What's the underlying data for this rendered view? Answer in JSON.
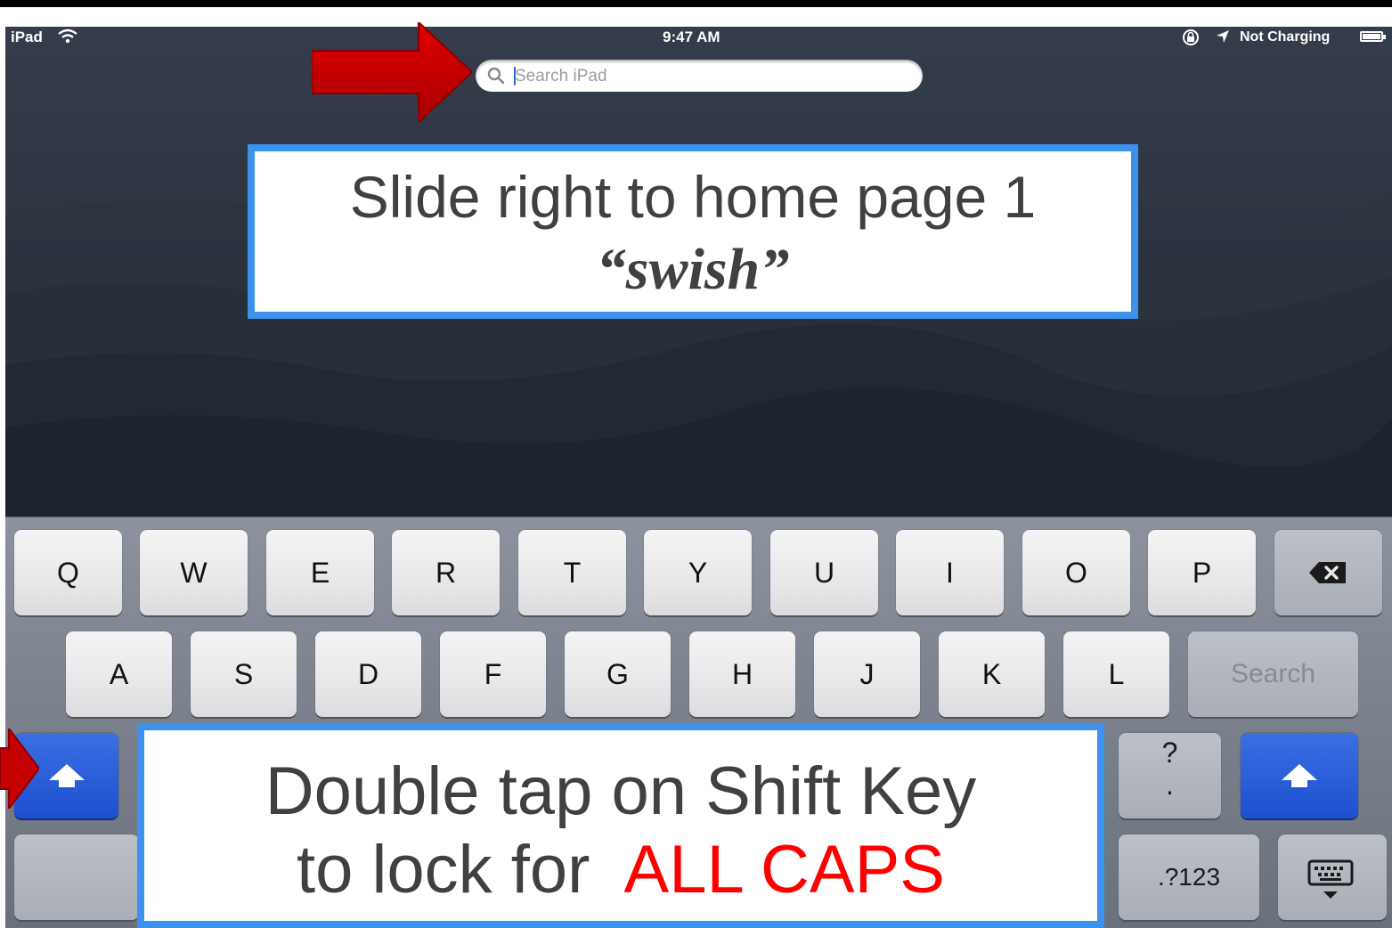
{
  "status_bar": {
    "device": "iPad",
    "time": "9:47 AM",
    "charging": "Not Charging",
    "wifi_icon": "wifi-icon",
    "lock_icon": "rotation-lock-icon",
    "location_icon": "location-arrow-icon",
    "battery_icon": "battery-icon"
  },
  "search": {
    "placeholder": "Search iPad",
    "icon": "search-icon"
  },
  "keyboard": {
    "row1": [
      "Q",
      "W",
      "E",
      "R",
      "T",
      "Y",
      "U",
      "I",
      "O",
      "P"
    ],
    "row2": [
      "A",
      "S",
      "D",
      "F",
      "G",
      "H",
      "J",
      "K",
      "L"
    ],
    "search_key": "Search",
    "punct_top": "?",
    "punct_bottom": ".",
    "numbers_key": ".?123",
    "backspace_icon": "backspace-icon",
    "shift_icon": "shift-arrow-icon",
    "hide_keyboard_icon": "hide-keyboard-icon"
  },
  "callouts": {
    "slide": {
      "line1": "Slide right to home page 1",
      "line2": "“swish”"
    },
    "shift": {
      "line1": "Double tap on Shift Key",
      "line2_prefix": "to lock for  ",
      "line2_emphasis": "ALL CAPS"
    }
  },
  "colors": {
    "callout_border": "#3d92ee",
    "arrow_red": "#c40000",
    "emphasis_red": "#ff0000",
    "shift_blue": "#2a5fde"
  }
}
